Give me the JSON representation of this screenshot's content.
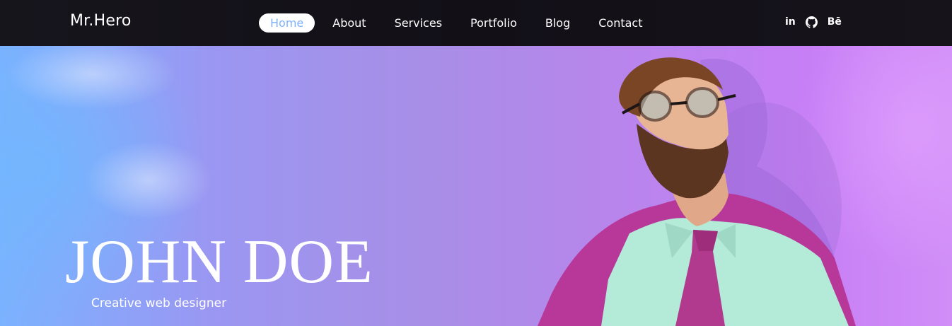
{
  "navbar": {
    "brand": "Mr.Hero",
    "links": [
      {
        "label": "Home",
        "active": true
      },
      {
        "label": "About",
        "active": false
      },
      {
        "label": "Services",
        "active": false
      },
      {
        "label": "Portfolio",
        "active": false
      },
      {
        "label": "Blog",
        "active": false
      },
      {
        "label": "Contact",
        "active": false
      }
    ],
    "social": [
      {
        "icon": "linkedin-icon",
        "text": "in"
      },
      {
        "icon": "github-icon",
        "text": ""
      },
      {
        "icon": "behance-icon",
        "text": "Bē"
      }
    ],
    "active_color": "#7fb1ff"
  },
  "hero": {
    "name": "JOHN DOE",
    "subtitle": "Creative web designer",
    "gradient_start": "#7bb2ff",
    "gradient_end": "#d08ef7"
  }
}
